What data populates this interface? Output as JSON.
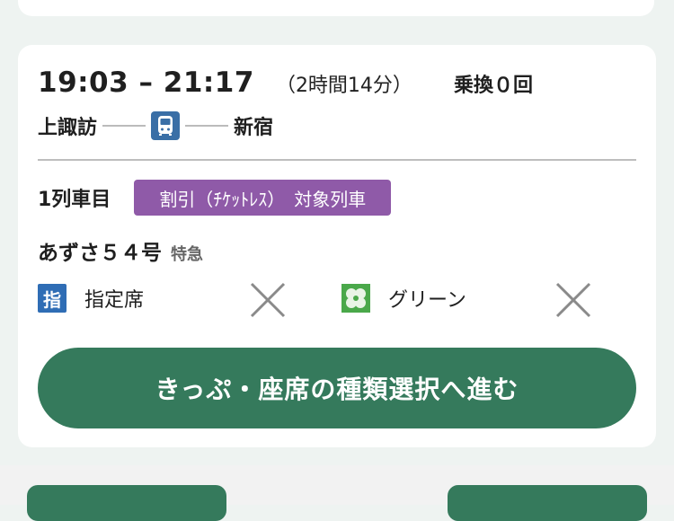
{
  "route": {
    "time_range": "19:03 – 21:17",
    "duration": "（2時間14分）",
    "transfers": "乗換０回",
    "from_station": "上諏訪",
    "to_station": "新宿"
  },
  "train": {
    "car_label": "1列車目",
    "discount_badge": "割引（ﾁｹｯﾄﾚｽ）　対象列車",
    "name": "あずさ５４号",
    "type": "特急"
  },
  "seats": {
    "reserved_icon_char": "指",
    "reserved_label": "指定席",
    "green_label": "グリーン"
  },
  "actions": {
    "proceed_label": "きっぷ・座席の種類選択へ進む"
  },
  "colors": {
    "accent_green": "#357a5c",
    "badge_purple": "#8f5aa8",
    "icon_blue": "#3a6fa6"
  }
}
